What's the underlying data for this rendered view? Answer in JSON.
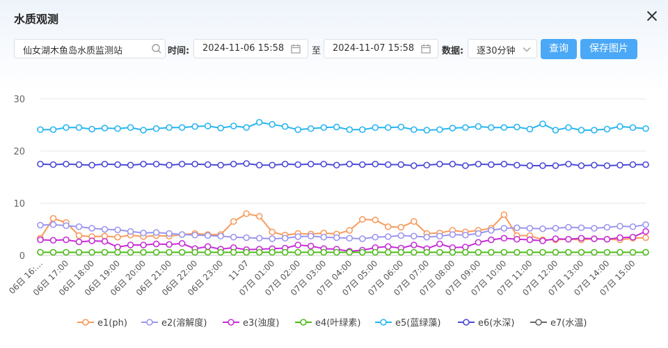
{
  "dialog": {
    "title": "水质观测"
  },
  "filters": {
    "station": "仙女湖木鱼岛水质监测站",
    "time_label": "时间:",
    "start_time": "2024-11-06 15:58",
    "to_label": "至",
    "end_time": "2024-11-07 15:58",
    "data_label": "数据:",
    "interval": "逐30分钟",
    "query_button": "查询",
    "save_button": "保存图片"
  },
  "colors": {
    "accent": "#4aa8f7",
    "e1": "#f79a5b",
    "e2": "#9a95ef",
    "e3": "#c72bd6",
    "e4": "#4cbb17",
    "e5": "#26b5f0",
    "e6": "#4b48d8",
    "e7": "#666666"
  },
  "chart_data": {
    "type": "line",
    "ylim": [
      0,
      30
    ],
    "yticks": [
      "0",
      "10",
      "20",
      "30"
    ],
    "grid": true,
    "legend_position": "bottom",
    "x_tick_labels": [
      "06日 16:…",
      "06日 17:00",
      "06日 18:00",
      "06日 19:00",
      "06日 20:00",
      "06日 21:00",
      "06日 22:00",
      "06日 23:00",
      "11-07",
      "07日 01:00",
      "07日 02:00",
      "07日 03:00",
      "07日 04:00",
      "07日 05:00",
      "07日 06:00",
      "07日 07:00",
      "07日 08:00",
      "07日 09:00",
      "07日 10:00",
      "07日 11:00",
      "07日 12:00",
      "07日 13:00",
      "07日 14:00",
      "07日 15:00"
    ],
    "series": [
      {
        "name": "e1(ph)",
        "color": "#f79a5b",
        "values": [
          3.3,
          7.1,
          6.3,
          3.8,
          3.6,
          3.7,
          3.5,
          3.9,
          3.6,
          3.8,
          3.7,
          4.0,
          4.2,
          4.0,
          4.0,
          6.5,
          8.0,
          7.5,
          4.5,
          3.9,
          4.2,
          4.1,
          4.3,
          4.1,
          4.8,
          6.9,
          6.8,
          5.5,
          5.4,
          6.5,
          4.2,
          4.3,
          4.8,
          4.5,
          4.8,
          5.2,
          7.8,
          3.8,
          3.8,
          3.0,
          3.0,
          3.1,
          3.0,
          3.2,
          3.1,
          3.0,
          3.3,
          3.4
        ]
      },
      {
        "name": "e2(溶解度)",
        "color": "#9a95ef",
        "values": [
          5.8,
          5.9,
          5.7,
          5.5,
          5.2,
          5.0,
          4.9,
          4.6,
          4.3,
          4.4,
          4.2,
          4.0,
          3.9,
          3.8,
          3.7,
          3.5,
          3.4,
          3.3,
          3.2,
          3.3,
          3.6,
          3.7,
          3.5,
          3.4,
          3.3,
          3.2,
          3.5,
          3.6,
          3.8,
          3.7,
          3.5,
          3.7,
          4.0,
          3.9,
          4.2,
          4.8,
          5.2,
          5.3,
          5.2,
          5.1,
          5.2,
          5.4,
          5.3,
          5.2,
          5.4,
          5.6,
          5.5,
          5.9
        ]
      },
      {
        "name": "e3(浊度)",
        "color": "#c72bd6",
        "values": [
          3.0,
          2.9,
          3.0,
          2.6,
          2.8,
          2.7,
          1.6,
          2.0,
          2.0,
          2.2,
          2.1,
          2.3,
          1.3,
          1.7,
          1.2,
          1.5,
          1.1,
          1.2,
          1.3,
          1.4,
          2.0,
          1.8,
          1.3,
          1.2,
          0.8,
          1.0,
          1.5,
          1.7,
          1.4,
          2.0,
          1.3,
          2.2,
          1.5,
          1.6,
          2.5,
          3.0,
          3.3,
          3.1,
          3.0,
          2.8,
          3.2,
          3.1,
          3.3,
          3.2,
          3.1,
          3.4,
          3.5,
          4.6
        ]
      },
      {
        "name": "e4(叶绿素)",
        "color": "#4cbb17",
        "values": [
          0.6,
          0.6,
          0.6,
          0.6,
          0.6,
          0.6,
          0.6,
          0.6,
          0.6,
          0.6,
          0.6,
          0.6,
          0.6,
          0.6,
          0.6,
          0.6,
          0.6,
          0.6,
          0.6,
          0.6,
          0.6,
          0.6,
          0.6,
          0.6,
          0.6,
          0.6,
          0.6,
          0.6,
          0.6,
          0.6,
          0.6,
          0.6,
          0.6,
          0.6,
          0.6,
          0.6,
          0.6,
          0.6,
          0.6,
          0.6,
          0.6,
          0.6,
          0.6,
          0.6,
          0.6,
          0.6,
          0.6,
          0.6
        ]
      },
      {
        "name": "e5(蓝绿藻)",
        "color": "#26b5f0",
        "values": [
          24.1,
          24.1,
          24.5,
          24.5,
          24.2,
          24.4,
          24.3,
          24.5,
          24.0,
          24.3,
          24.5,
          24.5,
          24.7,
          24.8,
          24.4,
          24.8,
          24.5,
          25.5,
          25.1,
          24.7,
          24.1,
          24.3,
          24.5,
          24.6,
          24.1,
          24.1,
          24.5,
          24.5,
          24.6,
          24.1,
          24.0,
          24.1,
          24.4,
          24.5,
          24.7,
          24.5,
          24.5,
          24.6,
          24.2,
          25.2,
          24.0,
          24.5,
          24.0,
          24.0,
          24.2,
          24.7,
          24.5,
          24.3
        ]
      },
      {
        "name": "e6(水深)",
        "color": "#4b48d8",
        "values": [
          17.5,
          17.4,
          17.5,
          17.4,
          17.3,
          17.5,
          17.4,
          17.3,
          17.5,
          17.5,
          17.3,
          17.5,
          17.5,
          17.4,
          17.3,
          17.5,
          17.6,
          17.3,
          17.3,
          17.5,
          17.4,
          17.5,
          17.5,
          17.3,
          17.5,
          17.4,
          17.5,
          17.4,
          17.4,
          17.2,
          17.3,
          17.5,
          17.5,
          17.2,
          17.5,
          17.4,
          17.5,
          17.3,
          17.2,
          17.2,
          17.2,
          17.5,
          17.2,
          17.3,
          17.2,
          17.3,
          17.4,
          17.4
        ]
      },
      {
        "name": "e7(水温)",
        "color": "#666666",
        "values": []
      }
    ]
  }
}
